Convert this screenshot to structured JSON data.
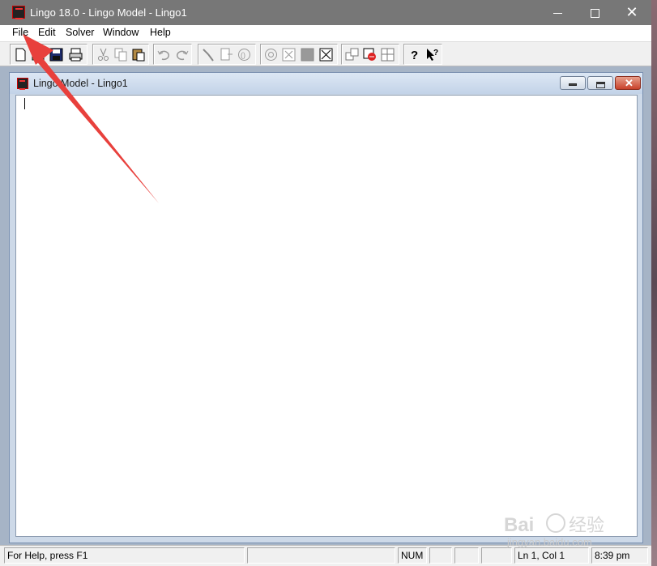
{
  "window": {
    "title": "Lingo 18.0 - Lingo Model - Lingo1",
    "app_icon": "lingo-sigma-icon"
  },
  "menu": {
    "items": [
      "File",
      "Edit",
      "Solver",
      "Window",
      "Help"
    ]
  },
  "toolbar": {
    "icons": [
      "new-icon",
      "open-icon",
      "save-icon",
      "print-icon",
      "cut-icon",
      "copy-icon",
      "paste-icon",
      "undo-icon",
      "redo-icon",
      "find-icon",
      "goto-line-icon",
      "match-paren-icon",
      "solve-icon",
      "solution-icon",
      "close-all-icon",
      "send-to-back-icon",
      "tile-icon",
      "options-icon",
      "cascade-icon",
      "help-icon",
      "context-help-icon"
    ]
  },
  "child_window": {
    "title": "Lingo Model - Lingo1",
    "editor_content": ""
  },
  "statusbar": {
    "help": "For Help, press F1",
    "num": "NUM",
    "position": "Ln 1, Col 1",
    "time": "8:39 pm"
  },
  "watermark": {
    "text": "jingyan.baidu.com"
  },
  "colors": {
    "annotation_arrow": "#e8403c",
    "titlebar": "#777777",
    "mdi_background": "#a6b4c6"
  }
}
